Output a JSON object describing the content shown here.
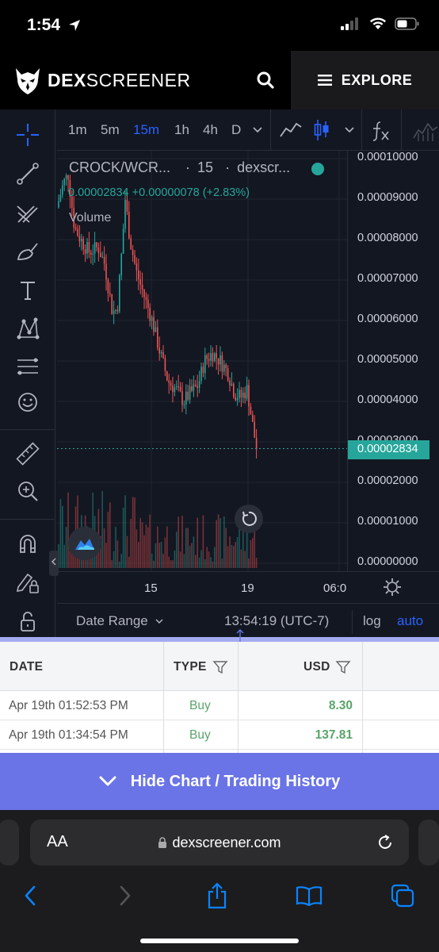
{
  "status": {
    "time": "1:54"
  },
  "header": {
    "logo_bold": "DEX",
    "logo_light": "SCREENER",
    "explore_label": "EXPLORE"
  },
  "chart": {
    "timeframes": [
      "1m",
      "5m",
      "15m",
      "1h",
      "4h",
      "D"
    ],
    "active_timeframe": "15m",
    "legend": {
      "symbol": "CROCK/WCR...",
      "interval": "15",
      "source": "dexscr...",
      "separator": "·",
      "price_change": "0.00002834 +0.00000078 (+2.83%)",
      "volume_label": "Volume"
    },
    "price_ticks": [
      "0.00010000",
      "0.00009000",
      "0.00008000",
      "0.00007000",
      "0.00006000",
      "0.00005000",
      "0.00004000",
      "0.00003000",
      "0.00002000",
      "0.00001000",
      "0.00000000"
    ],
    "last_price": "0.00002834",
    "time_ticks": [
      "15",
      "19",
      "06:0"
    ],
    "date_range_label": "Date Range",
    "clock": "13:54:19 (UTC-7)",
    "log_label": "log",
    "auto_label": "auto",
    "colors": {
      "up": "#26a69a",
      "down": "#ef5350",
      "accent": "#2962ff"
    }
  },
  "table": {
    "headers": {
      "date": "DATE",
      "type": "TYPE",
      "usd": "USD"
    },
    "rows": [
      {
        "date": "Apr 19th 01:52:53 PM",
        "type": "Buy",
        "usd": "8.30"
      },
      {
        "date": "Apr 19th 01:34:54 PM",
        "type": "Buy",
        "usd": "137.81"
      }
    ]
  },
  "hide_chart_label": "Hide Chart / Trading History",
  "safari": {
    "aa_label": "AA",
    "url": "dexscreener.com"
  }
}
